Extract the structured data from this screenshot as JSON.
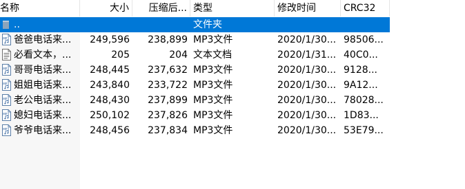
{
  "columns": {
    "name": "名称",
    "size": "大小",
    "packed": "压缩后...",
    "type": "类型",
    "modified": "修改时间",
    "crc": "CRC32"
  },
  "parent_row": {
    "name": "..",
    "type": "文件夹",
    "icon": "folder-up-icon"
  },
  "files": [
    {
      "name": "爸爸电话来...",
      "size": "249,596",
      "packed": "238,899",
      "type": "MP3文件",
      "modified": "2020/1/30...",
      "crc": "98506...",
      "icon": "mp3-file-icon"
    },
    {
      "name": "必看文本，...",
      "size": "205",
      "packed": "204",
      "type": "文本文档",
      "modified": "2020/1/31...",
      "crc": "40C0...",
      "icon": "text-file-icon"
    },
    {
      "name": "哥哥电话来...",
      "size": "248,445",
      "packed": "237,632",
      "type": "MP3文件",
      "modified": "2020/1/30...",
      "crc": "9128...",
      "icon": "mp3-file-icon"
    },
    {
      "name": "姐姐电话来...",
      "size": "243,840",
      "packed": "233,722",
      "type": "MP3文件",
      "modified": "2020/1/30...",
      "crc": "9A12...",
      "icon": "mp3-file-icon"
    },
    {
      "name": "老公电话来...",
      "size": "248,430",
      "packed": "237,899",
      "type": "MP3文件",
      "modified": "2020/1/30...",
      "crc": "78028...",
      "icon": "mp3-file-icon"
    },
    {
      "name": "媳妇电话来...",
      "size": "250,102",
      "packed": "237,826",
      "type": "MP3文件",
      "modified": "2020/1/30...",
      "crc": "1D83...",
      "icon": "mp3-file-icon"
    },
    {
      "name": "爷爷电话来...",
      "size": "248,456",
      "packed": "237,834",
      "type": "MP3文件",
      "modified": "2020/1/30...",
      "crc": "53E79...",
      "icon": "mp3-file-icon"
    }
  ],
  "colors": {
    "selection": "#0078d7",
    "header_divider": "#e5e5e5",
    "name_column_bg": "#f7f7f7"
  }
}
